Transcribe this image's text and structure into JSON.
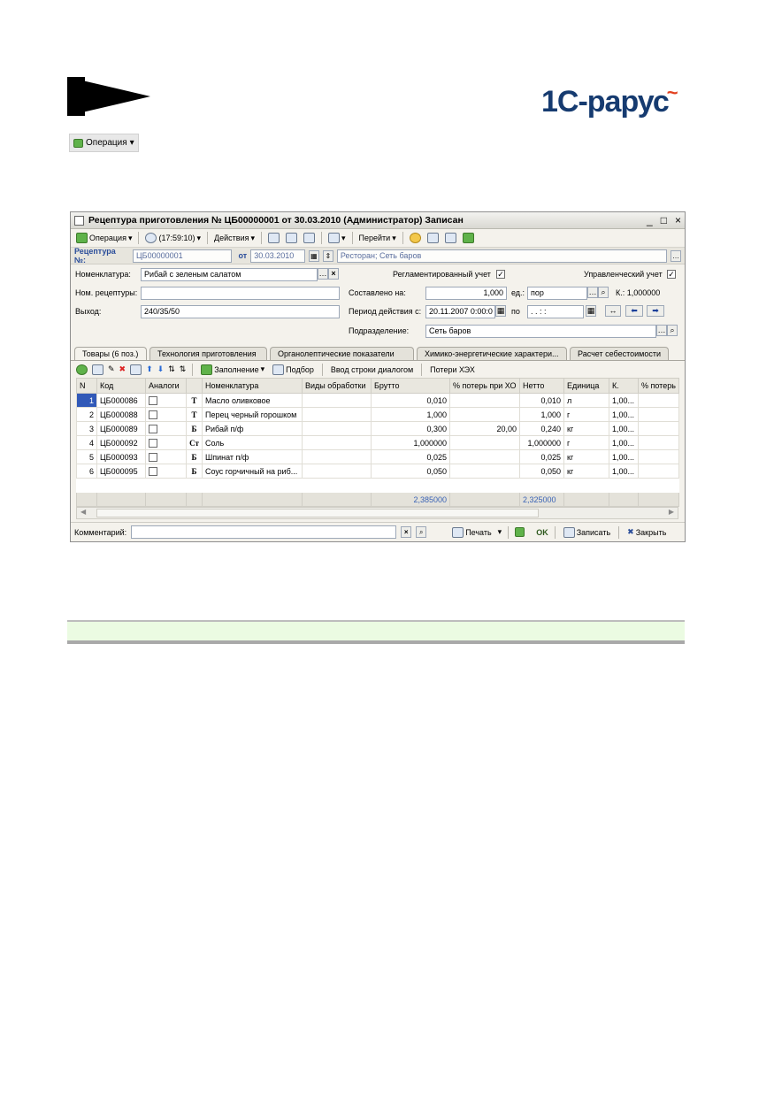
{
  "brand": {
    "logo": "1С-рарус"
  },
  "top_op": {
    "label": "Операция"
  },
  "window": {
    "title": "Рецептура приготовления № ЦБ00000001 от 30.03.2010 (Администратор) Записан",
    "controls": [
      "_",
      "□",
      "×"
    ]
  },
  "toolbar": {
    "operation": "Операция",
    "time": "(17:59:10)",
    "actions": "Действия",
    "goto": "Перейти"
  },
  "doc": {
    "label": "Рецептура №:",
    "number": "ЦБ00000001",
    "from_label": "от",
    "date": "30.03.2010",
    "org": "Ресторан; Сеть баров"
  },
  "form": {
    "nomenclature_label": "Номенклатура:",
    "nomenclature": "Рибай с зеленым салатом",
    "recipe_num_label": "Ном. рецептуры:",
    "recipe_num": "",
    "output_label": "Выход:",
    "output": "240/35/50",
    "regulated_label": "Регламентированный учет",
    "management_label": "Управленческий учет",
    "composed_label": "Составлено на:",
    "composed": "1,000",
    "unit_label": "ед.:",
    "unit": "пор",
    "coef": "К.: 1,000000",
    "period_label": "Период действия с:",
    "period_from": "20.11.2007  0:00:0",
    "period_to_label": "по",
    "period_to": ". .   : :",
    "division_label": "Подразделение:",
    "division": "Сеть баров"
  },
  "tabs": [
    "Товары (6 поз.)",
    "Технология приготовления",
    "Органолептические показатели",
    "Химико-энергетические характери...",
    "Расчет себестоимости"
  ],
  "grid_toolbar": {
    "fill": "Заполнение",
    "pick": "Подбор",
    "dialog": "Ввод строки диалогом",
    "losses": "Потери ХЭХ"
  },
  "table": {
    "columns": [
      "N",
      "Код",
      "Аналоги",
      "",
      "Номенклатура",
      "Виды обработки",
      "Брутто",
      "% потерь при ХО",
      "Нетто",
      "Единица",
      "К.",
      "% потерь"
    ],
    "rows": [
      {
        "n": "1",
        "code": "ЦБ000086",
        "mark": "Т",
        "name": "Масло оливковое",
        "proc": "",
        "gross": "0,010",
        "loss": "",
        "net": "0,010",
        "unit": "л",
        "k": "1,00...",
        "loss2": ""
      },
      {
        "n": "2",
        "code": "ЦБ000088",
        "mark": "Т",
        "name": "Перец черный горошком",
        "proc": "",
        "gross": "1,000",
        "loss": "",
        "net": "1,000",
        "unit": "г",
        "k": "1,00...",
        "loss2": ""
      },
      {
        "n": "3",
        "code": "ЦБ000089",
        "mark": "Б",
        "name": "Рибай п/ф",
        "proc": "",
        "gross": "0,300",
        "loss": "20,00",
        "net": "0,240",
        "unit": "кг",
        "k": "1,00...",
        "loss2": ""
      },
      {
        "n": "4",
        "code": "ЦБ000092",
        "mark": "Ст",
        "name": "Соль",
        "proc": "",
        "gross": "1,000000",
        "loss": "",
        "net": "1,000000",
        "unit": "г",
        "k": "1,00...",
        "loss2": ""
      },
      {
        "n": "5",
        "code": "ЦБ000093",
        "mark": "Б",
        "name": "Шпинат п/ф",
        "proc": "",
        "gross": "0,025",
        "loss": "",
        "net": "0,025",
        "unit": "кг",
        "k": "1,00...",
        "loss2": ""
      },
      {
        "n": "6",
        "code": "ЦБ000095",
        "mark": "Б",
        "name": "Соус горчичный на риб...",
        "proc": "",
        "gross": "0,050",
        "loss": "",
        "net": "0,050",
        "unit": "кг",
        "k": "1,00...",
        "loss2": ""
      }
    ],
    "totals": {
      "gross": "2,385000",
      "net": "2,325000"
    }
  },
  "bottom": {
    "comment_label": "Комментарий:",
    "comment": "",
    "print": "Печать",
    "ok": "OK",
    "save": "Записать",
    "close": "Закрыть"
  }
}
